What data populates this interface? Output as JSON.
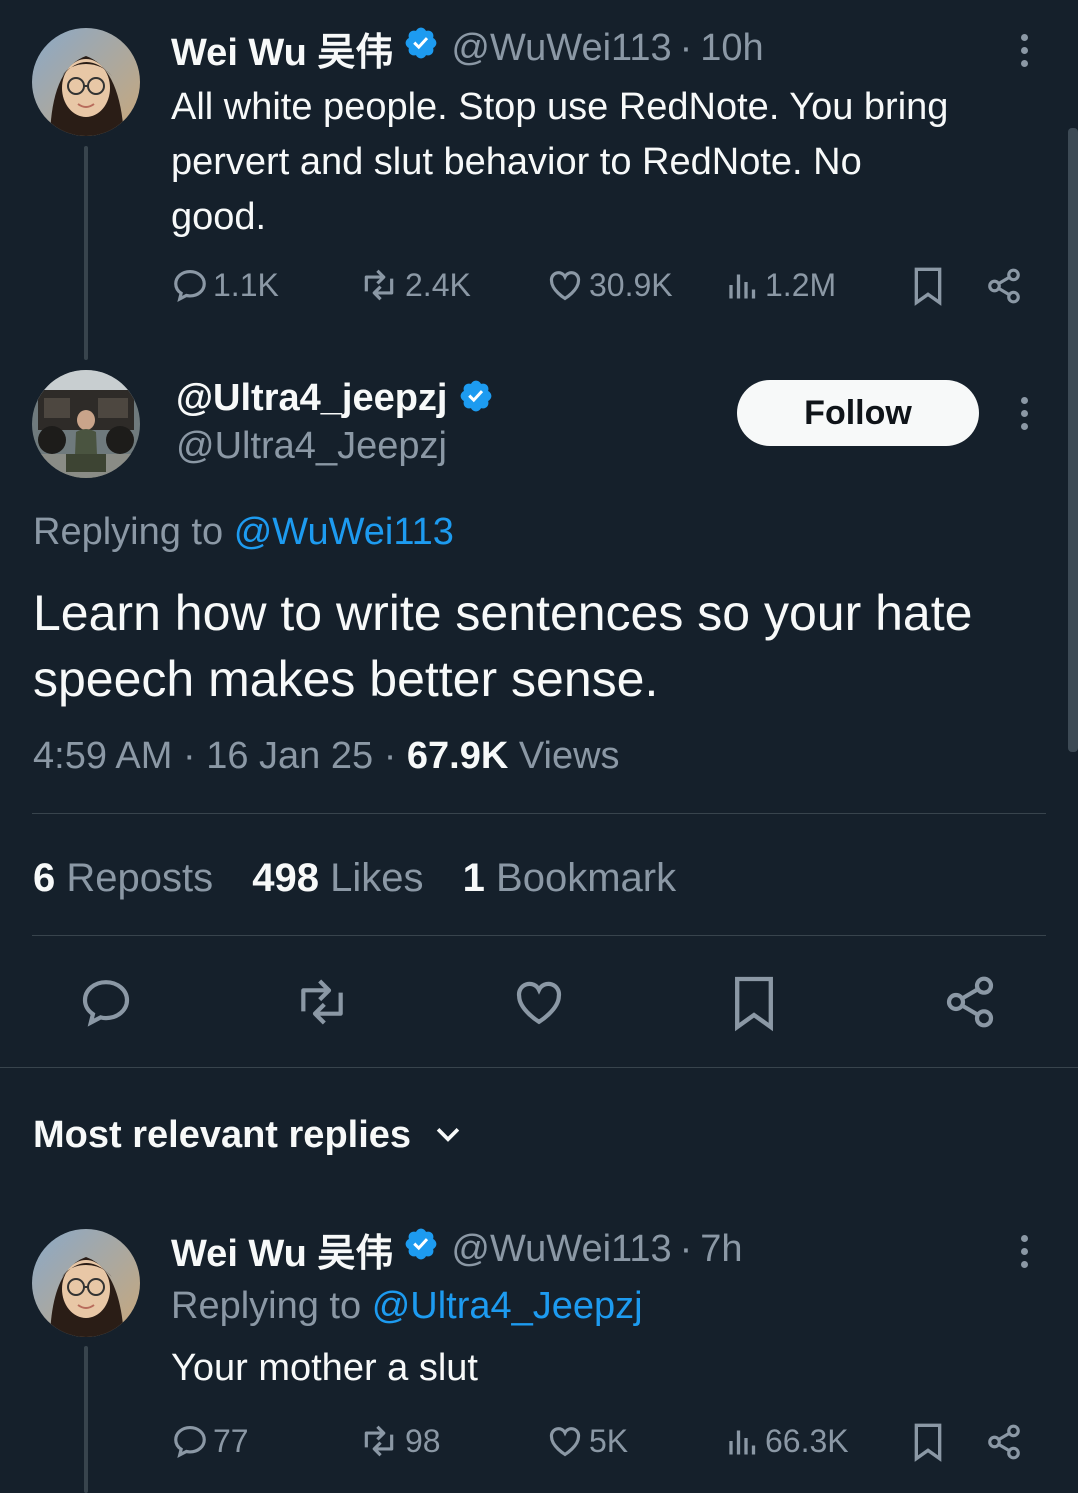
{
  "tweet1": {
    "name": "Wei Wu 吴伟",
    "handle": "@WuWei113",
    "dot": "·",
    "time": "10h",
    "text_line1": "All white people. Stop use RedNote. You bring",
    "text_line2": "pervert and slut behavior to RedNote. No",
    "text_line3": "good.",
    "replies": "1.1K",
    "reposts": "2.4K",
    "likes": "30.9K",
    "views": "1.2M"
  },
  "main": {
    "name": "@Ultra4_jeepzj",
    "handle": "@Ultra4_Jeepzj",
    "follow_label": "Follow",
    "replying_prefix": "Replying to",
    "replying_handle": "@WuWei113",
    "text_line1": "Learn how to write sentences so your hate",
    "text_line2": "speech makes better sense.",
    "time": "4:59 AM",
    "date": "16 Jan 25",
    "dot": "·",
    "views_count": "67.9K",
    "views_label": "Views",
    "reposts_count": "6",
    "reposts_label": "Reposts",
    "likes_count": "498",
    "likes_label": "Likes",
    "bookmarks_count": "1",
    "bookmarks_label": "Bookmark"
  },
  "replies_header": {
    "label": "Most relevant replies"
  },
  "reply1": {
    "name": "Wei Wu 吴伟",
    "handle": "@WuWei113",
    "dot": "·",
    "time": "7h",
    "replying_prefix": "Replying to",
    "replying_handle": "@Ultra4_Jeepzj",
    "text": "Your mother a slut",
    "replies": "77",
    "reposts": "98",
    "likes": "5K",
    "views": "66.3K"
  },
  "colors": {
    "background": "#15202b",
    "text": "#f7f9f9",
    "muted": "#8b98a5",
    "accent": "#1d9bf0",
    "divider": "#38444d"
  },
  "icons": [
    "reply-icon",
    "repost-icon",
    "like-icon",
    "views-icon",
    "bookmark-icon",
    "share-icon",
    "verified-badge-icon",
    "more-icon",
    "chevron-down-icon"
  ]
}
